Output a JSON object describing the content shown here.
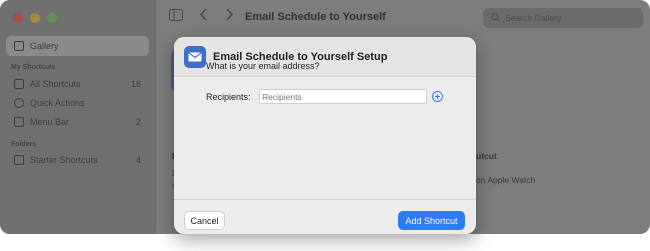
{
  "sidebar": {
    "gallery": "Gallery",
    "my_shortcuts_header": "My Shortcuts",
    "items": [
      {
        "label": "All Shortcuts",
        "count": "16"
      },
      {
        "label": "Quick Actions",
        "count": ""
      },
      {
        "label": "Menu Bar",
        "count": "2"
      }
    ],
    "folders_header": "Folders",
    "folders": [
      {
        "label": "Starter Shortcuts",
        "count": "4"
      }
    ]
  },
  "toolbar": {
    "title": "Email Schedule to Yourself",
    "search_placeholder": "Search Gallery"
  },
  "background": {
    "right_header": "utcut",
    "right_text": "on Apple Watch",
    "left_letter_1": "D",
    "left_letter_2": "S",
    "left_letter_3": "s"
  },
  "dialog": {
    "title": "Email Schedule to Yourself Setup",
    "question": "What is your email address?",
    "recipients_label": "Recipients:",
    "recipients_placeholder": "Recipients",
    "recipients_value": "",
    "cancel_label": "Cancel",
    "add_label": "Add Shortcut"
  },
  "colors": {
    "accent": "#2f7bf5",
    "app_icon": "#3e6fc9"
  },
  "icons": [
    "sidebar-toggle-icon",
    "back-chevron-icon",
    "forward-chevron-icon",
    "search-icon",
    "mail-icon",
    "add-circle-icon"
  ]
}
